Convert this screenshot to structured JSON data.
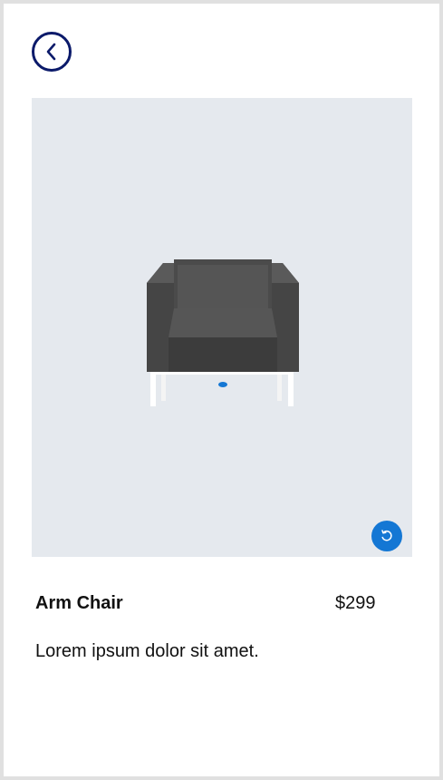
{
  "header": {
    "back_icon": "chevron-left-icon"
  },
  "viewer": {
    "model": "arm-chair-3d",
    "reset_icon": "rotate-reset-icon",
    "accent": "#1477d4"
  },
  "product": {
    "name": "Arm Chair",
    "price": "$299",
    "description": "Lorem ipsum dolor sit amet."
  },
  "colors": {
    "back_border": "#0b1a6a",
    "viewer_bg": "#e5e9ee"
  }
}
